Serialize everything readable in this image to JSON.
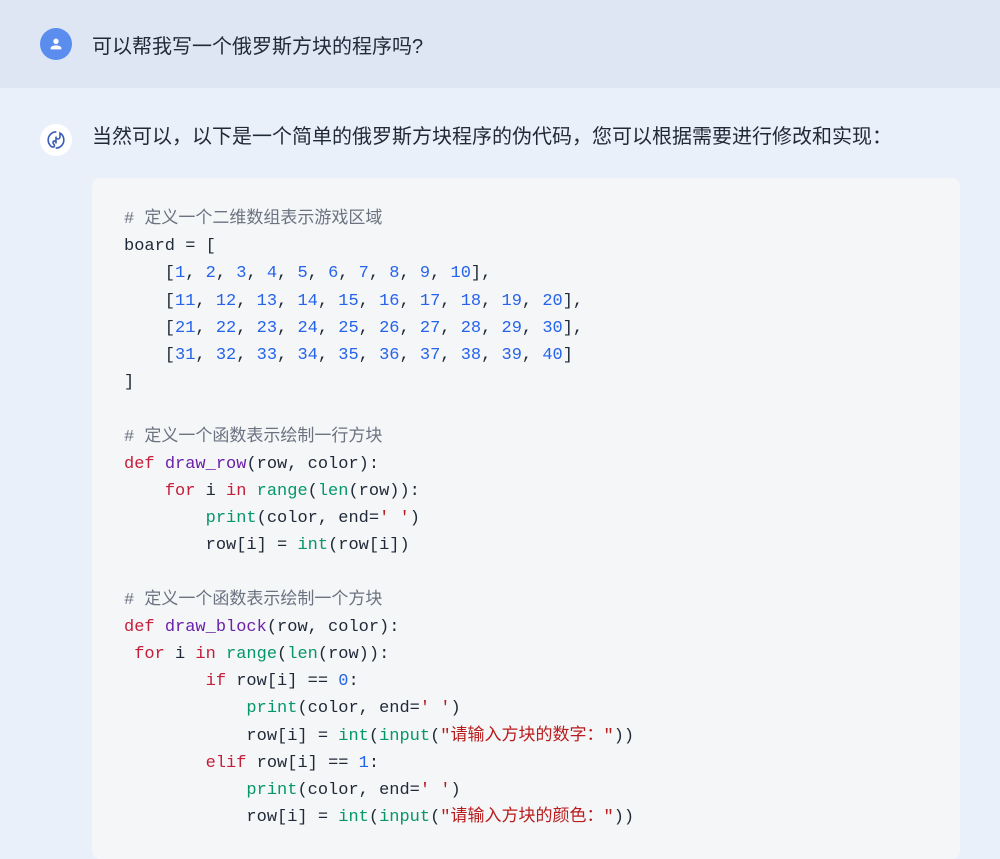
{
  "user": {
    "message": "可以帮我写一个俄罗斯方块的程序吗?"
  },
  "assistant": {
    "intro": "当然可以，以下是一个简单的俄罗斯方块程序的伪代码，您可以根据需要进行修改和实现：",
    "code": {
      "comment1": "# 定义一个二维数组表示游戏区域",
      "board_assign": "board = [",
      "row1_nums": [
        "1",
        "2",
        "3",
        "4",
        "5",
        "6",
        "7",
        "8",
        "9",
        "10"
      ],
      "row2_nums": [
        "11",
        "12",
        "13",
        "14",
        "15",
        "16",
        "17",
        "18",
        "19",
        "20"
      ],
      "row3_nums": [
        "21",
        "22",
        "23",
        "24",
        "25",
        "26",
        "27",
        "28",
        "29",
        "30"
      ],
      "row4_nums": [
        "31",
        "32",
        "33",
        "34",
        "35",
        "36",
        "37",
        "38",
        "39",
        "40"
      ],
      "close_bracket": "]",
      "comment2": "# 定义一个函数表示绘制一行方块",
      "def_kw": "def",
      "draw_row_name": "draw_row",
      "draw_row_params": "(row, color):",
      "for_kw": "for",
      "in_kw": "in",
      "range_kw": "range",
      "len_kw": "len",
      "print_kw": "print",
      "int_kw": "int",
      "input_kw": "input",
      "if_kw": "if",
      "elif_kw": "elif",
      "end_str": "' '",
      "end_kwarg": "end=",
      "for_i": "i",
      "row_var": "row",
      "color_var": "color",
      "row_idx": "row[i]",
      "zero": "0",
      "one": "1",
      "eq": "==",
      "assign": "=",
      "comment3": "# 定义一个函数表示绘制一个方块",
      "draw_block_name": "draw_block",
      "draw_block_params": "(row, color):",
      "input_str1": "\"请输入方块的数字：\"",
      "input_str2": "\"请输入方块的颜色：\""
    }
  }
}
